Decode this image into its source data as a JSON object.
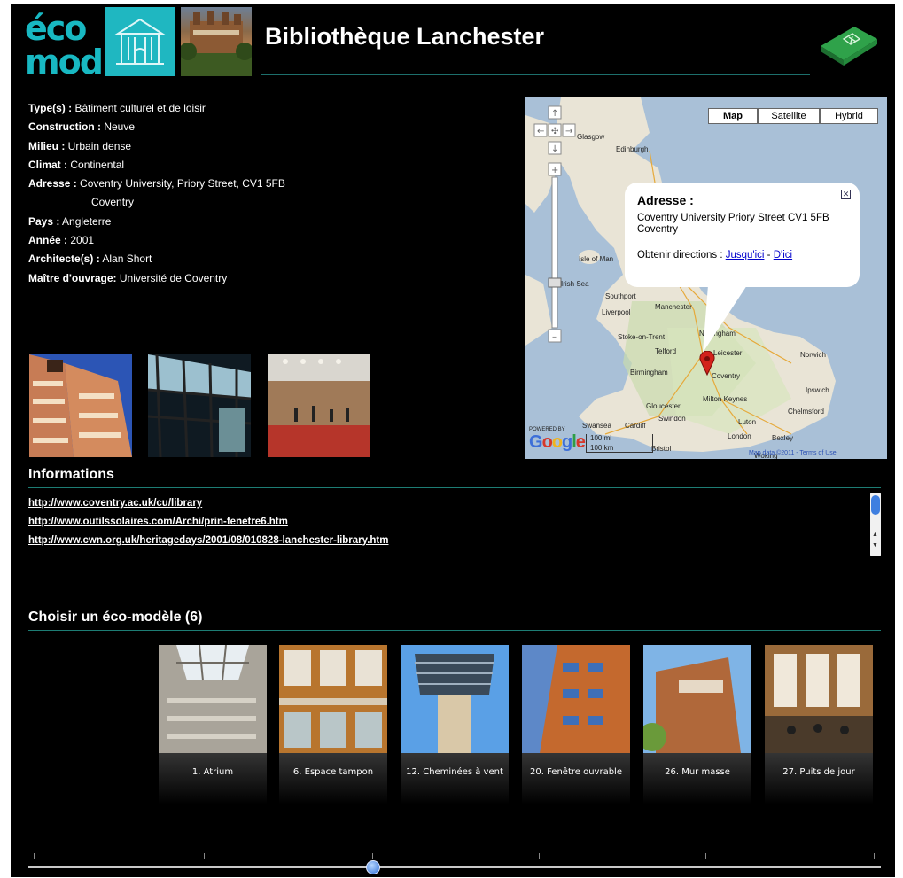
{
  "header": {
    "logo_line1": "éco",
    "logo_line2": "mod",
    "title": "Bibliothèque Lanchester",
    "type_icon": "library-building-icon",
    "book_icon": "green-book-icon"
  },
  "info": {
    "rows": [
      {
        "label": "Type(s) :",
        "value": " Bâtiment culturel et de loisir"
      },
      {
        "label": "Construction :",
        "value": " Neuve"
      },
      {
        "label": "Milieu :",
        "value": " Urbain dense"
      },
      {
        "label": "Climat :",
        "value": " Continental"
      },
      {
        "label": "Adresse :",
        "value": "  Coventry University, Priory Street, CV1 5FB"
      },
      {
        "label": "",
        "value": "Coventry"
      },
      {
        "label": "Pays :",
        "value": " Angleterre"
      },
      {
        "label": "Année :",
        "value": " 2001"
      },
      {
        "label": "Architecte(s) :",
        "value": " Alan Short"
      },
      {
        "label": "Maître d'ouvrage:",
        "value": " Université de Coventry"
      }
    ]
  },
  "map": {
    "types": [
      "Map",
      "Satellite",
      "Hybrid"
    ],
    "active_type": "Map",
    "popup": {
      "title": "Adresse :",
      "address_line1": "Coventry University Priory Street CV1 5FB",
      "address_line2": "Coventry",
      "directions_label": "Obtenir directions :",
      "link_here": "Jusqu'ici",
      "separator": "-",
      "link_from": "D'ici"
    },
    "places": [
      "Glasgow",
      "Edinburgh",
      "Isle of Man",
      "Irish Sea",
      "Southport",
      "Liverpool",
      "Manchester",
      "Stoke-on-Trent",
      "Nottingham",
      "Telford",
      "Leicester",
      "Birmingham",
      "Coventry",
      "Norwich",
      "Ipswich",
      "Milton Keynes",
      "Gloucester",
      "Chelmsford",
      "Luton",
      "Swansea",
      "Cardiff",
      "Swindon",
      "London",
      "Bexley",
      "Bristol",
      "Woking"
    ],
    "scale_mi": "100 mi",
    "scale_km": "100 km",
    "powered_by": "POWERED BY",
    "google": "Google",
    "attribution": "Map data ©2011 - Terms of Use",
    "marker": "map-marker-icon"
  },
  "informations": {
    "title": "Informations",
    "links": [
      "http://www.coventry.ac.uk/cu/library",
      "http://www.outilssolaires.com/Archi/prin-fenetre6.htm",
      "http://www.cwn.org.uk/heritagedays/2001/08/010828-lanchester-library.htm"
    ]
  },
  "ecomodel": {
    "title": "Choisir un éco-modèle (6)",
    "items": [
      {
        "caption": "1. Atrium"
      },
      {
        "caption": "6. Espace tampon"
      },
      {
        "caption": "12. Cheminées à vent"
      },
      {
        "caption": "20. Fenêtre ouvrable"
      },
      {
        "caption": "26. Mur masse"
      },
      {
        "caption": "27. Puits de jour"
      }
    ]
  },
  "slider": {
    "position": 0.4
  }
}
